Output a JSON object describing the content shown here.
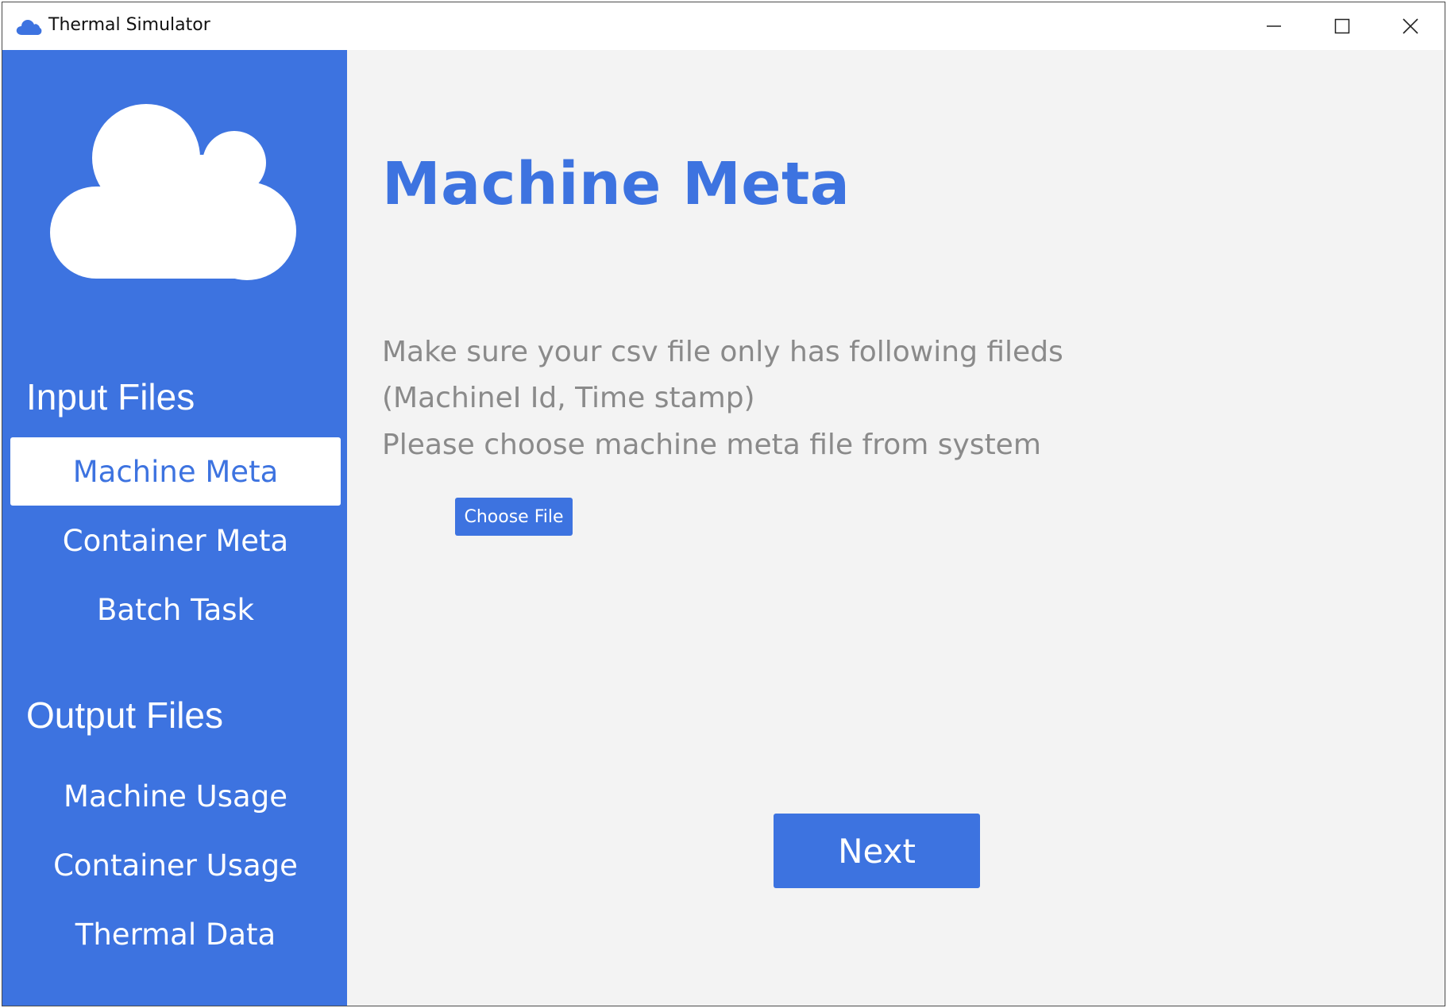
{
  "window": {
    "title": "Thermal Simulator",
    "app_icon": "cloud-icon",
    "controls": [
      "minimize-icon",
      "maximize-icon",
      "close-icon"
    ]
  },
  "colors": {
    "accent": "#3d73e0",
    "background": "#f3f3f3",
    "muted_text": "#8a8a8a",
    "white": "#ffffff"
  },
  "sidebar": {
    "logo": "cloud-icon",
    "input_section": {
      "title": "Input Files",
      "items": [
        {
          "label": "Machine Meta",
          "active": true
        },
        {
          "label": "Container Meta",
          "active": false
        },
        {
          "label": "Batch Task",
          "active": false
        }
      ]
    },
    "output_section": {
      "title": "Output Files",
      "items": [
        {
          "label": "Machine Usage",
          "active": false
        },
        {
          "label": "Container Usage",
          "active": false
        },
        {
          "label": "Thermal Data",
          "active": false
        }
      ]
    }
  },
  "main": {
    "title": "Machine Meta",
    "description": [
      "Make sure your csv file only has following fileds",
      "(MachineI Id, Time stamp)",
      "Please choose machine meta file from system"
    ],
    "choose_file_label": "Choose File",
    "next_label": "Next"
  }
}
